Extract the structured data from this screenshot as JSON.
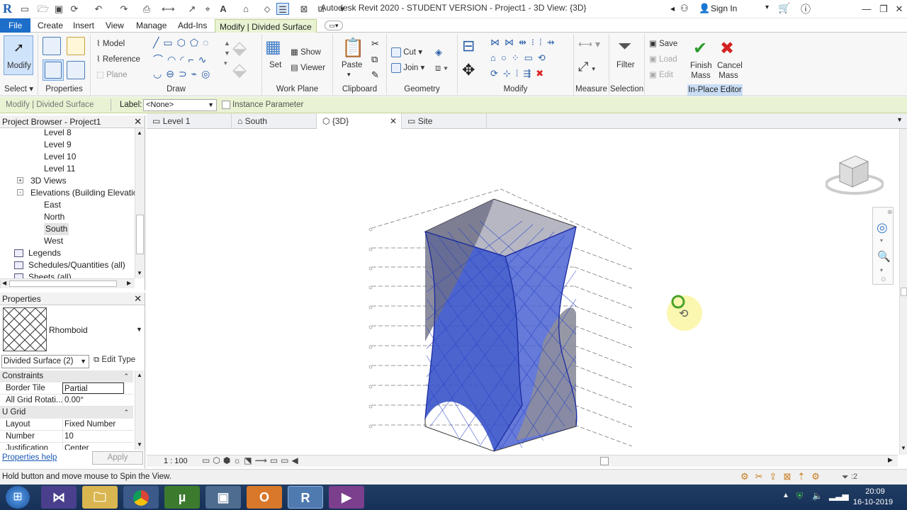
{
  "app": {
    "title": "Autodesk Revit 2020 - STUDENT VERSION - Project1 - 3D View: {3D}",
    "sign_in": "Sign In",
    "logo": "R"
  },
  "ribbon_tabs": [
    "File",
    "Create",
    "Insert",
    "View",
    "Manage",
    "Add-Ins",
    "Modify | Divided Surface"
  ],
  "ribbon": {
    "select": {
      "modify": "Modify",
      "label": "Select"
    },
    "properties": {
      "label": "Properties"
    },
    "draw": {
      "model": "Model",
      "reference": "Reference",
      "plane": "Plane",
      "label": "Draw"
    },
    "work_plane": {
      "set": "Set",
      "show": "Show",
      "viewer": "Viewer",
      "label": "Work Plane"
    },
    "clipboard": {
      "paste": "Paste",
      "label": "Clipboard"
    },
    "geometry": {
      "cut": "Cut",
      "join": "Join",
      "label": "Geometry"
    },
    "modify": {
      "label": "Modify"
    },
    "measure": {
      "label": "Measure"
    },
    "selection": {
      "filter": "Filter",
      "label": "Selection"
    },
    "in_place_editor": {
      "save": "Save",
      "load": "Load",
      "edit": "Edit",
      "finish_mass": "Finish Mass",
      "cancel_mass": "Cancel Mass",
      "label": "In-Place Editor"
    }
  },
  "options_bar": {
    "context": "Modify | Divided Surface",
    "label": "Label:",
    "label_value": "<None>",
    "instance_param": "Instance Parameter"
  },
  "view_tabs": [
    "Level 1",
    "South",
    "{3D}",
    "Site"
  ],
  "project_browser": {
    "title": "Project Browser - Project1",
    "items": [
      {
        "label": "Level 8",
        "indent": 2
      },
      {
        "label": "Level 9",
        "indent": 2
      },
      {
        "label": "Level 10",
        "indent": 2
      },
      {
        "label": "Level 11",
        "indent": 2
      },
      {
        "label": "3D Views",
        "indent": 1,
        "expand": "+"
      },
      {
        "label": "Elevations (Building Elevation",
        "indent": 1,
        "expand": "-"
      },
      {
        "label": "East",
        "indent": 2
      },
      {
        "label": "North",
        "indent": 2
      },
      {
        "label": "South",
        "indent": 2,
        "selected": true
      },
      {
        "label": "West",
        "indent": 2
      },
      {
        "label": "Legends",
        "indent": 0
      },
      {
        "label": "Schedules/Quantities (all)",
        "indent": 0
      },
      {
        "label": "Sheets (all)",
        "indent": 0
      }
    ]
  },
  "properties": {
    "title": "Properties",
    "type_name": "Rhomboid",
    "instance_select": "Divided Surface (2)",
    "edit_type": "Edit Type",
    "rows": [
      {
        "cat": "Constraints"
      },
      {
        "k": "Border Tile",
        "v": "Partial"
      },
      {
        "k": "All Grid Rotati...",
        "v": "0.00°"
      },
      {
        "cat": "U Grid"
      },
      {
        "k": "Layout",
        "v": "Fixed Number"
      },
      {
        "k": "Number",
        "v": "10"
      },
      {
        "k": "Justification",
        "v": "Center"
      }
    ],
    "help": "Properties help",
    "apply": "Apply"
  },
  "view_controls": {
    "scale": "1 : 100"
  },
  "status": {
    "message": "Hold button and move mouse to Spin the View.",
    "filter_count": ":2"
  },
  "taskbar": {
    "time": "20:09",
    "date": "16-10-2019"
  },
  "colors": {
    "file_tab": "#1c6ec9",
    "context_green": "#e9f3d3",
    "mesh_blue": "#2a52d6",
    "taskbar": "#1b355d"
  }
}
